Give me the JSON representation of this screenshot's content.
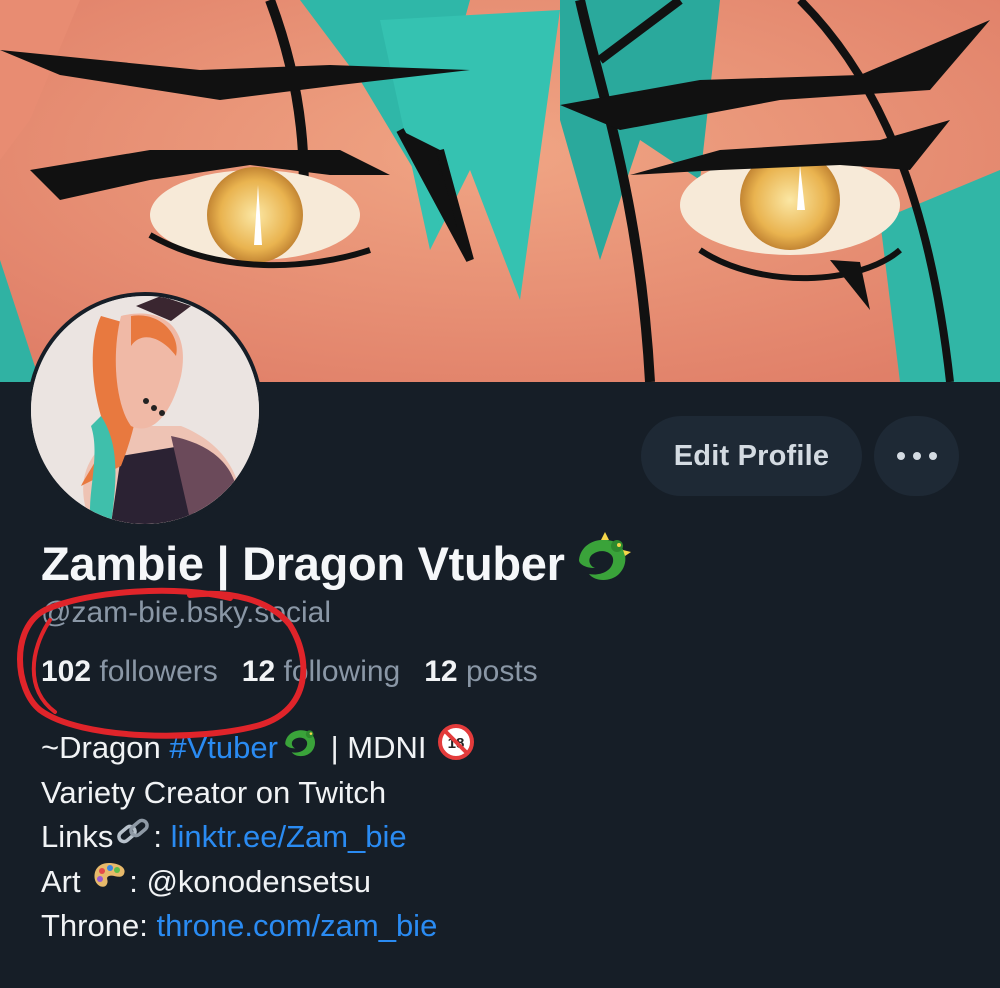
{
  "profile": {
    "display_name": "Zambie | Dragon Vtuber",
    "name_emoji": "dragon-icon",
    "handle": "@zam-bie.bsky.social"
  },
  "actions": {
    "edit_label": "Edit Profile",
    "more_icon": "more-horizontal-icon"
  },
  "stats": [
    {
      "count": "102",
      "label": "followers"
    },
    {
      "count": "12",
      "label": "following"
    },
    {
      "count": "12",
      "label": "posts"
    }
  ],
  "bio": {
    "line1": {
      "prefix": "~Dragon ",
      "tag": "#Vtuber",
      "sep": " | MDNI "
    },
    "line2": "Variety Creator on Twitch",
    "line3": {
      "label": "Links",
      "sep": ": ",
      "link": "linktr.ee/Zam_bie"
    },
    "line4": {
      "label": "Art ",
      "sep": ": @konodensetsu"
    },
    "line5": {
      "label": "Throne: ",
      "link": "throne.com/zam_bie"
    }
  },
  "colors": {
    "background": "#161e27",
    "button": "#1e2935",
    "link": "#2a8bf2",
    "muted": "#8a97a6",
    "annotation": "#e0242a"
  }
}
